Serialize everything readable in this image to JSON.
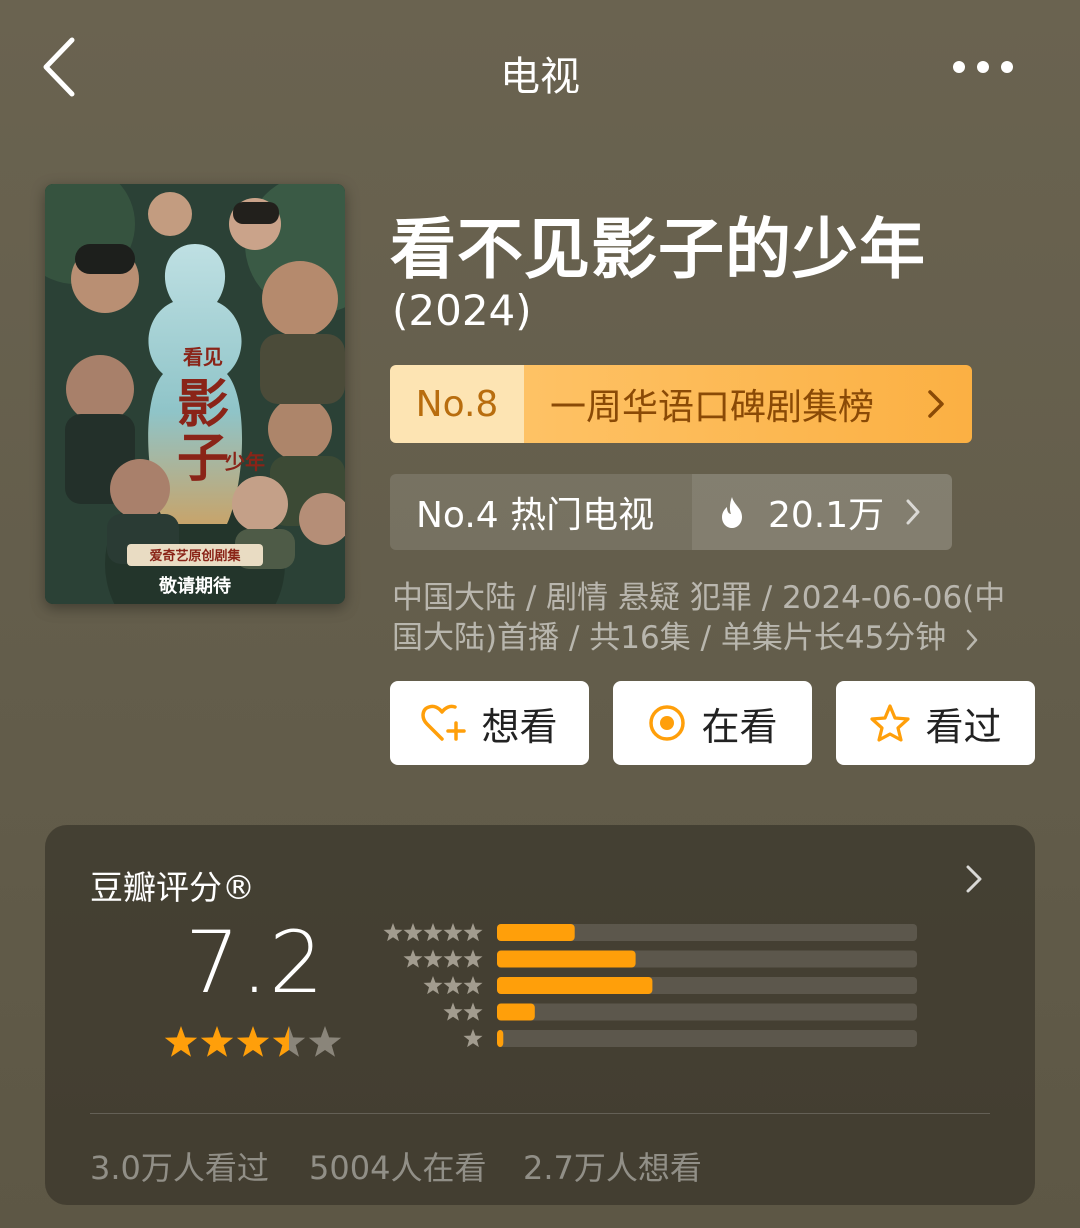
{
  "nav": {
    "title": "电视"
  },
  "poster": {
    "title_art": "看不见影子的少年",
    "badge": "爱奇艺原创剧集",
    "bottom": "敬请期待"
  },
  "show": {
    "title": "看不见影子的少年",
    "year": "(2024)",
    "info_line1": "中国大陆 / 剧情 悬疑 犯罪 / 2024-06-06(中",
    "info_line2": "国大陆)首播 / 共16集 / 单集片长45分钟"
  },
  "ranks": {
    "primary": {
      "no": "No.8",
      "label": "一周华语口碑剧集榜"
    },
    "secondary": {
      "no": "No.4 热门电视",
      "hot": "20.1万"
    }
  },
  "actions": {
    "want": "想看",
    "watching": "在看",
    "watched": "看过"
  },
  "rating": {
    "title": "豆瓣评分®",
    "score": "7.2",
    "stars": 3.5,
    "distribution_percent": [
      18.5,
      33.0,
      37.0,
      9.0,
      1.5
    ]
  },
  "stats": {
    "watched": "3.0万人看过",
    "watching": "5004人在看",
    "want": "2.7万人想看"
  },
  "colors": {
    "accent_orange": "#ff9f0a",
    "rank_gold": "#fbb043",
    "background": "#665f4c"
  }
}
